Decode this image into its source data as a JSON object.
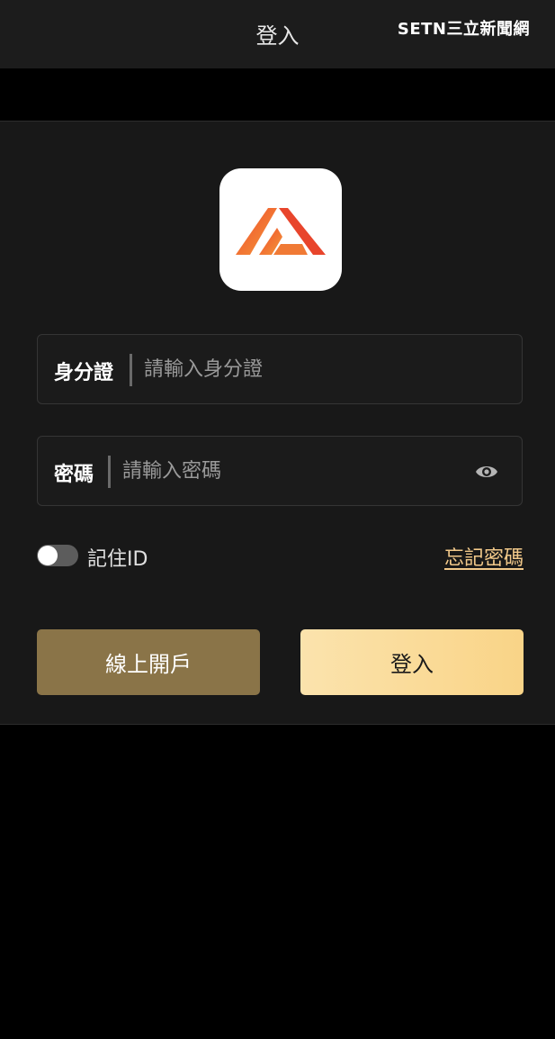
{
  "header": {
    "title": "登入",
    "watermark": "SETN三立新聞網"
  },
  "app": {
    "logo_icon": "brand-logo-icon",
    "brand_colors": [
      "#ee4a2f",
      "#f7a13a"
    ]
  },
  "form": {
    "id_label": "身分證",
    "id_placeholder": "請輸入身分證",
    "id_value": "",
    "password_label": "密碼",
    "password_placeholder": "請輸入密碼",
    "password_value": "",
    "password_toggle_icon": "eye-icon",
    "remember_label": "記住ID",
    "remember_checked": false,
    "forgot_label": "忘記密碼"
  },
  "buttons": {
    "open_account_label": "線上開戶",
    "login_label": "登入"
  },
  "colors": {
    "background": "#000000",
    "panel": "#181818",
    "accent_gold": "#f2c98a",
    "open_button": "#8a7448",
    "login_button": "#fbe3ad"
  }
}
